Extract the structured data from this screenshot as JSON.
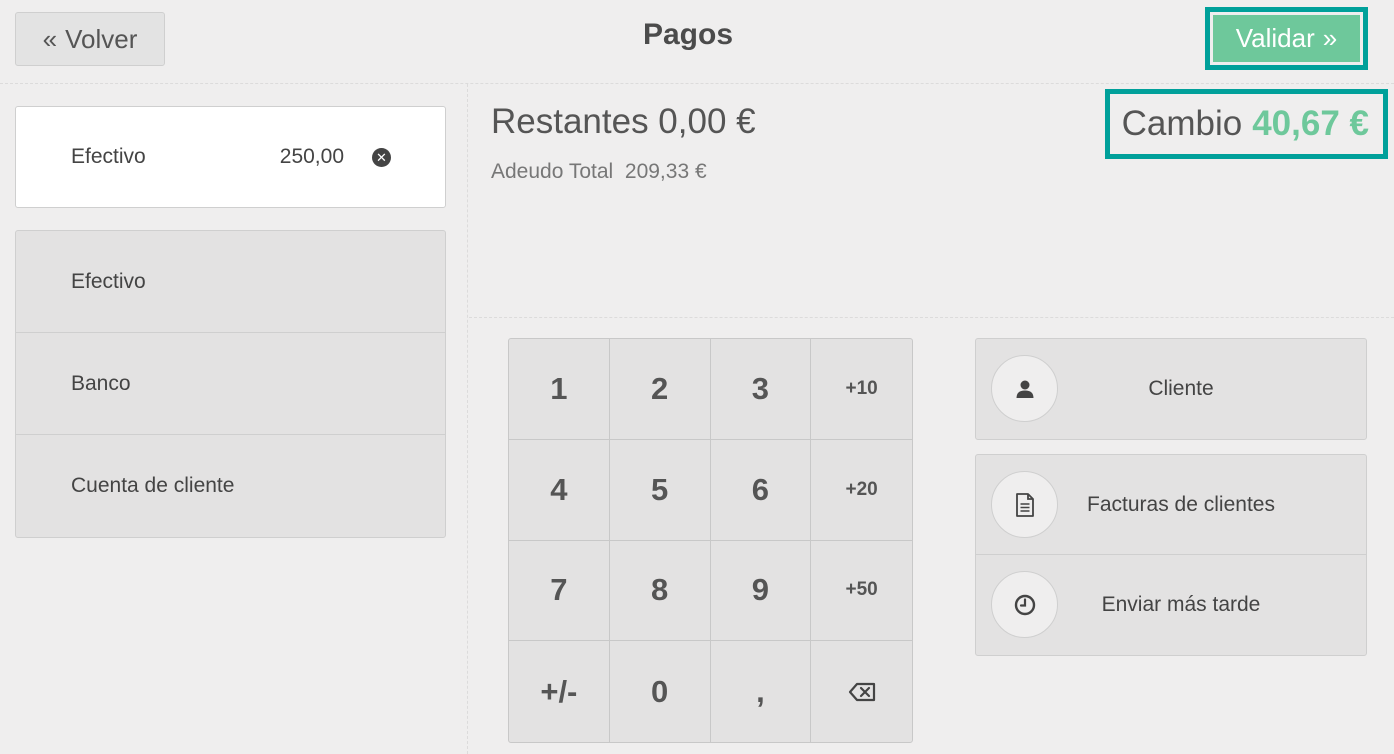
{
  "header": {
    "back_label": "Volver",
    "title": "Pagos",
    "validate_label": "Validar"
  },
  "paymentlines": [
    {
      "method": "Efectivo",
      "amount": "250,00"
    }
  ],
  "payment_methods": [
    {
      "label": "Efectivo"
    },
    {
      "label": "Banco"
    },
    {
      "label": "Cuenta de cliente"
    }
  ],
  "summary": {
    "remaining": "Restantes 0,00 €",
    "total_due_label": "Adeudo Total",
    "total_due_value": "209,33 €",
    "change_label": "Cambio",
    "change_value": "40,67 €"
  },
  "numpad": {
    "keys": [
      "1",
      "2",
      "3",
      "+10",
      "4",
      "5",
      "6",
      "+20",
      "7",
      "8",
      "9",
      "+50",
      "+/-",
      "0",
      ","
    ]
  },
  "actions": {
    "customer": "Cliente",
    "invoice": "Facturas de clientes",
    "send_later": "Enviar más tarde"
  },
  "colors": {
    "accent": "#6ec89b",
    "highlight_frame": "#00a09a"
  },
  "icons": {
    "back": "double-chevron-left-icon",
    "validate": "double-chevron-right-icon",
    "remove_line": "close-circle-icon",
    "customer": "user-icon",
    "invoice": "document-icon",
    "send_later": "clock-icon",
    "backspace": "backspace-icon"
  }
}
